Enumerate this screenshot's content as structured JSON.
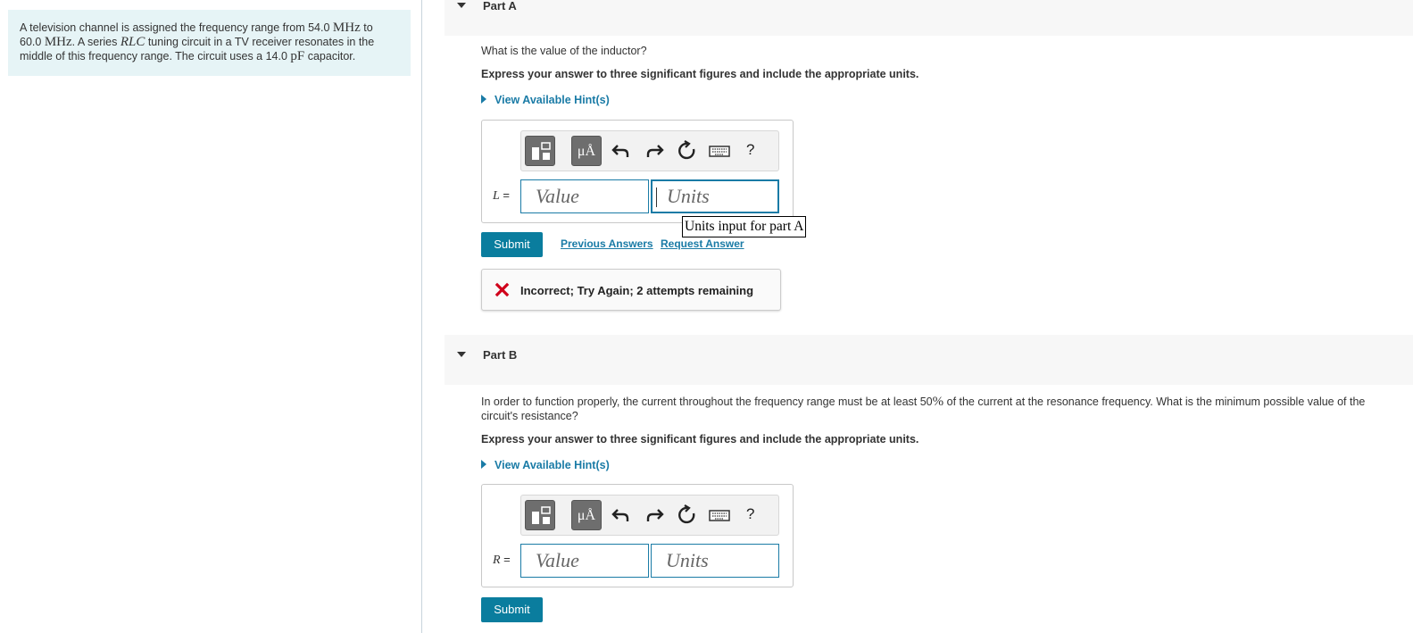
{
  "problem": {
    "t1": "A television channel is assigned the frequency range from 54.0 ",
    "u1": "MHz",
    "t2": " to",
    "t3": "60.0 ",
    "u2": "MHz",
    "t4": ". A series ",
    "rlc": "RLC",
    "t5": " tuning circuit in a TV receiver resonates in the",
    "t6": "middle of this frequency range. The circuit uses a 14.0 ",
    "u3": "pF",
    "t7": " capacitor."
  },
  "toolbar": {
    "mu_label": "μÅ",
    "help_label": "?",
    "icons": [
      "templates-icon",
      "units-mu-icon",
      "undo-icon",
      "redo-icon",
      "reset-icon",
      "keyboard-icon",
      "help-icon"
    ]
  },
  "partA": {
    "label": "Part A",
    "question": "What is the value of the inductor?",
    "instructions": "Express your answer to three significant figures and include the appropriate units.",
    "hint": "View Available Hint(s)",
    "var": "L",
    "eq": " =",
    "value_placeholder": "Value",
    "units_placeholder": "Units",
    "tooltip": "Units input for part A",
    "submit": "Submit",
    "previous_answers": "Previous Answers",
    "request_answer": "Request Answer",
    "feedback": "Incorrect; Try Again; 2 attempts remaining"
  },
  "partB": {
    "label": "Part B",
    "question_pre": "In order to function properly, the current throughout the frequency range must be at least 50",
    "question_pct": "%",
    "question_post": " of the current at the resonance frequency. What is the minimum possible value of the",
    "question_line2": "circuit's resistance?",
    "instructions": "Express your answer to three significant figures and include the appropriate units.",
    "hint": "View Available Hint(s)",
    "var": "R",
    "eq": " =",
    "value_placeholder": "Value",
    "units_placeholder": "Units",
    "submit": "Submit"
  },
  "colors": {
    "accent": "#1a7ba6",
    "submit_bg": "#0a7d9e",
    "error": "#d0021b",
    "problem_bg": "#e6f4f6"
  }
}
